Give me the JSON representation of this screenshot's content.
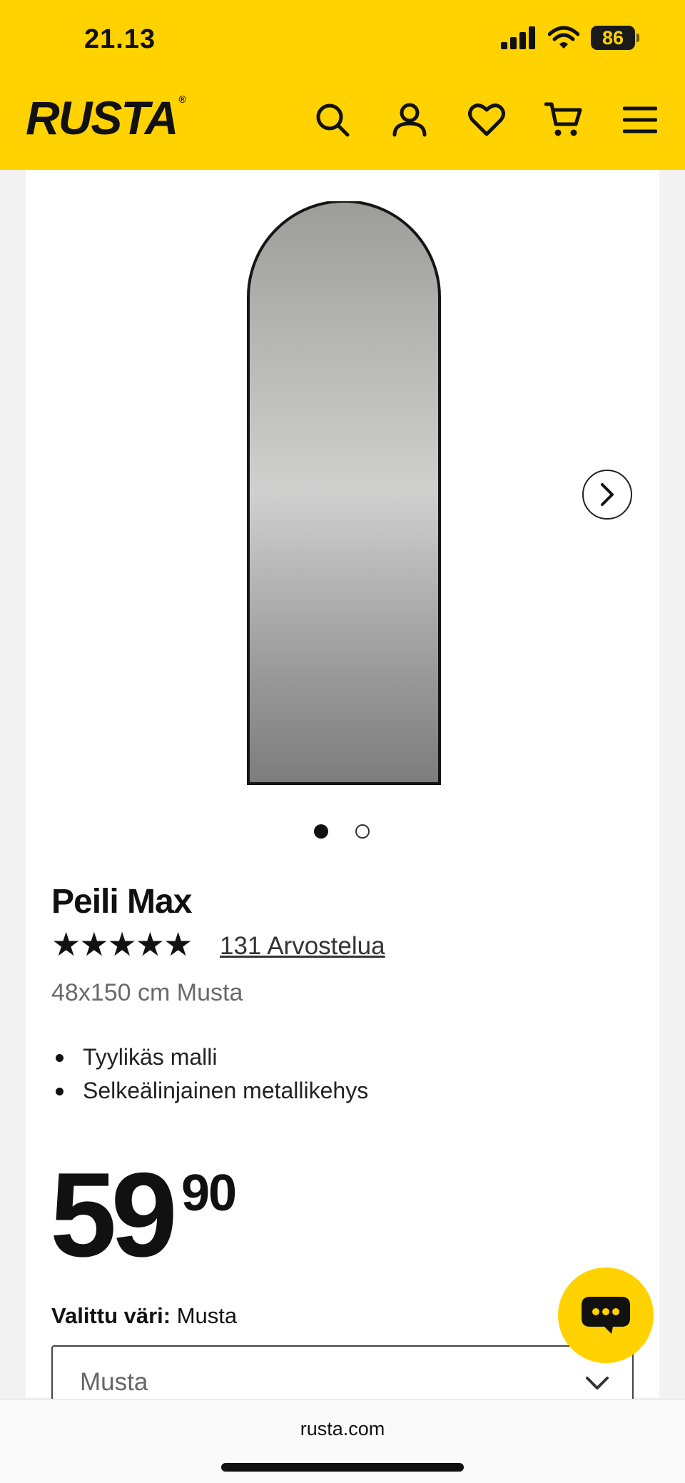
{
  "status_bar": {
    "time": "21.13",
    "battery": "86"
  },
  "header": {
    "logo": "RUSTA",
    "logo_mark": "®"
  },
  "gallery": {
    "images": 2,
    "active_index": 0
  },
  "product": {
    "title": "Peili Max",
    "rating_stars": "★★★★★",
    "rating": 5,
    "reviews_label": "131 Arvostelua",
    "variant": "48x150 cm Musta",
    "features": [
      "Tyylikäs malli",
      "Selkeälinjainen metallikehys"
    ],
    "price_int": "59",
    "price_dec": "90",
    "color_label": "Valittu väri:",
    "color_value": "Musta",
    "select_value": "Musta"
  },
  "browser": {
    "url": "rusta.com"
  },
  "colors": {
    "brand_yellow": "#ffd200",
    "text": "#111111"
  },
  "icons": [
    "search-icon",
    "account-icon",
    "heart-icon",
    "cart-icon",
    "menu-icon",
    "chevron-right-icon",
    "chevron-down-icon",
    "chat-icon"
  ]
}
